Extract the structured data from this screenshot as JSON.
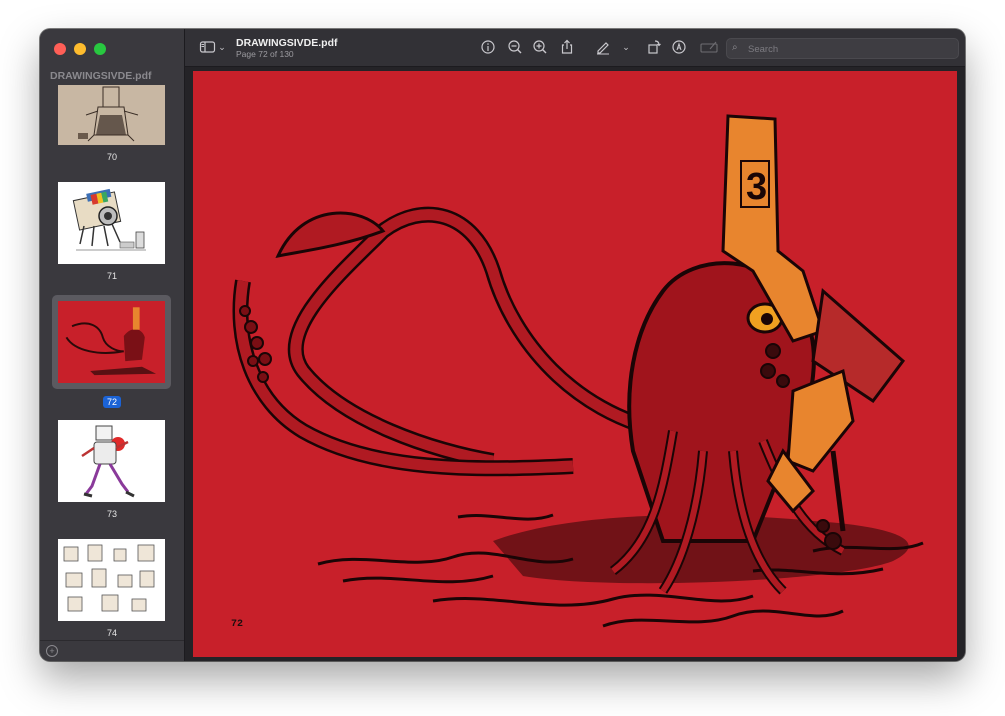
{
  "sidebar": {
    "title": "DRAWINGSIVDE.pdf",
    "thumbnails": [
      {
        "label": "70"
      },
      {
        "label": "71"
      },
      {
        "label": "72",
        "selected": true
      },
      {
        "label": "73"
      },
      {
        "label": "74"
      }
    ]
  },
  "toolbar": {
    "doc_title": "DRAWINGSIVDE.pdf",
    "doc_subtitle": "Page 72 of 130",
    "search_placeholder": "Search"
  },
  "page": {
    "number": "72",
    "helmet_number": "3",
    "background": "#c8202a"
  },
  "colors": {
    "selection": "#1b63d6",
    "page_red": "#c8202a",
    "helmet_orange": "#e8852e"
  }
}
